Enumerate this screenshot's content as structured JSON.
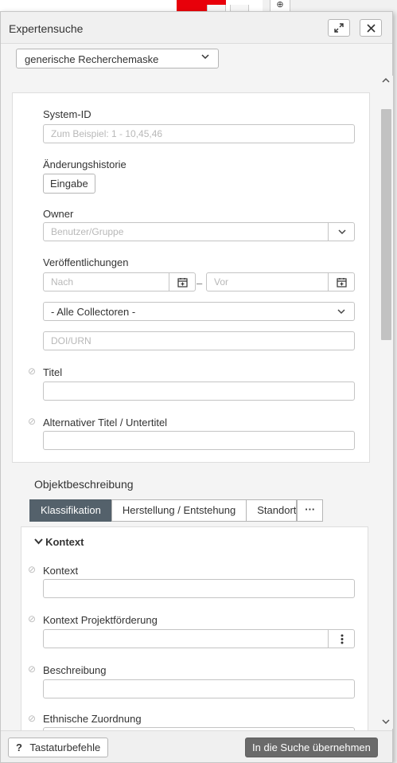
{
  "dialog": {
    "title": "Expertensuche",
    "mask_select": "generische Recherchemaske"
  },
  "fields": {
    "system_id": {
      "label": "System-ID",
      "placeholder": "Zum Beispiel: 1 - 10,45,46"
    },
    "history": {
      "label": "Änderungshistorie",
      "button": "Eingabe"
    },
    "owner": {
      "label": "Owner",
      "placeholder": "Benutzer/Gruppe"
    },
    "publications": {
      "label": "Veröffentlichungen",
      "from_placeholder": "Nach",
      "separator": "–",
      "to_placeholder": "Vor",
      "collectors": "- Alle Collectoren -",
      "doi_placeholder": "DOI/URN"
    },
    "title": {
      "label": "Titel"
    },
    "alt_title": {
      "label": "Alternativer Titel / Untertitel"
    }
  },
  "object": {
    "section_title": "Objektbeschreibung",
    "tabs": [
      {
        "label": "Klassifikation"
      },
      {
        "label": "Herstellung / Entstehung"
      },
      {
        "label": "Standort"
      }
    ],
    "more": "···",
    "group_title": "Kontext",
    "fields": [
      {
        "label": "Kontext"
      },
      {
        "label": "Kontext Projektförderung"
      },
      {
        "label": "Beschreibung"
      },
      {
        "label": "Ethnische Zuordnung"
      }
    ]
  },
  "footer": {
    "shortcuts_icon": "?",
    "shortcuts_label": "Tastaturbefehle",
    "apply_label": "In die Suche übernehmen"
  },
  "icons": {
    "expand": "expand-icon",
    "close": "close-icon",
    "calendar": "calendar-icon",
    "more_vertical": "more-vertical-icon",
    "ban": "ban-icon"
  },
  "colors": {
    "accent_tab": "#54616b",
    "apply_button": "#6a6a6a",
    "background_red": "#e8000a"
  }
}
